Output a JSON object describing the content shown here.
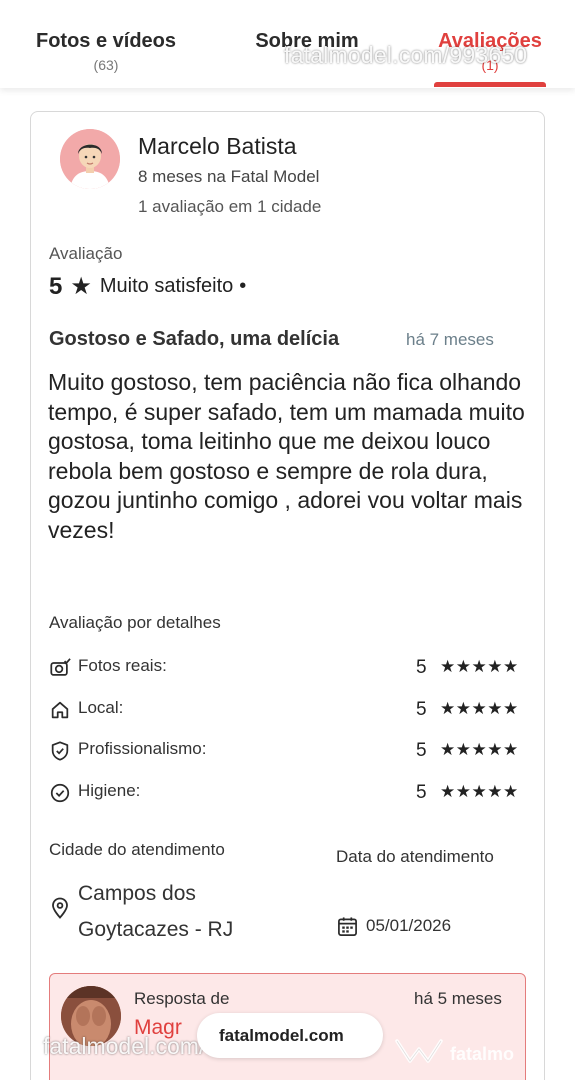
{
  "tabs": [
    {
      "label": "Fotos e vídeos",
      "count": "(63)"
    },
    {
      "label": "Sobre mim",
      "count": ""
    },
    {
      "label": "Avaliações",
      "count": "(1)"
    }
  ],
  "watermark": {
    "url": "fatalmodel.com/993650",
    "pill": "fatalmodel.com",
    "brand": "fatalmo"
  },
  "review": {
    "reviewer": {
      "name": "Marcelo Batista",
      "since": "8 meses na Fatal Model",
      "count": "1 avaliação em 1 cidade"
    },
    "rating_label": "Avaliação",
    "rating": {
      "value": "5",
      "star": "★",
      "text": "Muito satisfeito",
      "dot": "•"
    },
    "title": "Gostoso e Safado, uma delícia",
    "time": "há 7 meses",
    "body": "Muito gostoso, tem paciência não fica olhando tempo, é super safado, tem um mamada muito gostosa, toma leitinho que me deixou louco rebola bem gostoso e sempre de rola dura, gozou juntinho comigo , adorei vou voltar mais vezes!",
    "details_label": "Avaliação por detalhes",
    "details": [
      {
        "icon": "camera-check-icon",
        "label": "Fotos reais:",
        "value": "5",
        "stars": "★★★★★"
      },
      {
        "icon": "home-icon",
        "label": "Local:",
        "value": "5",
        "stars": "★★★★★"
      },
      {
        "icon": "shield-check-icon",
        "label": "Profissionalismo:",
        "value": "5",
        "stars": "★★★★★"
      },
      {
        "icon": "check-circle-icon",
        "label": "Higiene:",
        "value": "5",
        "stars": "★★★★★"
      }
    ],
    "city_label": "Cidade do atendimento",
    "city": "Campos dos Goytacazes - RJ",
    "date_label": "Data do atendimento",
    "date": "05/01/2026",
    "reply": {
      "label": "Resposta de",
      "name": "Magr",
      "time": "há 5 meses"
    }
  },
  "colors": {
    "accent": "#e0403e",
    "reply_bg": "#fde8e8",
    "reply_border": "#e47c7c",
    "avatar_bg": "#f2a9a9",
    "muted_time": "#6b7f8a"
  }
}
